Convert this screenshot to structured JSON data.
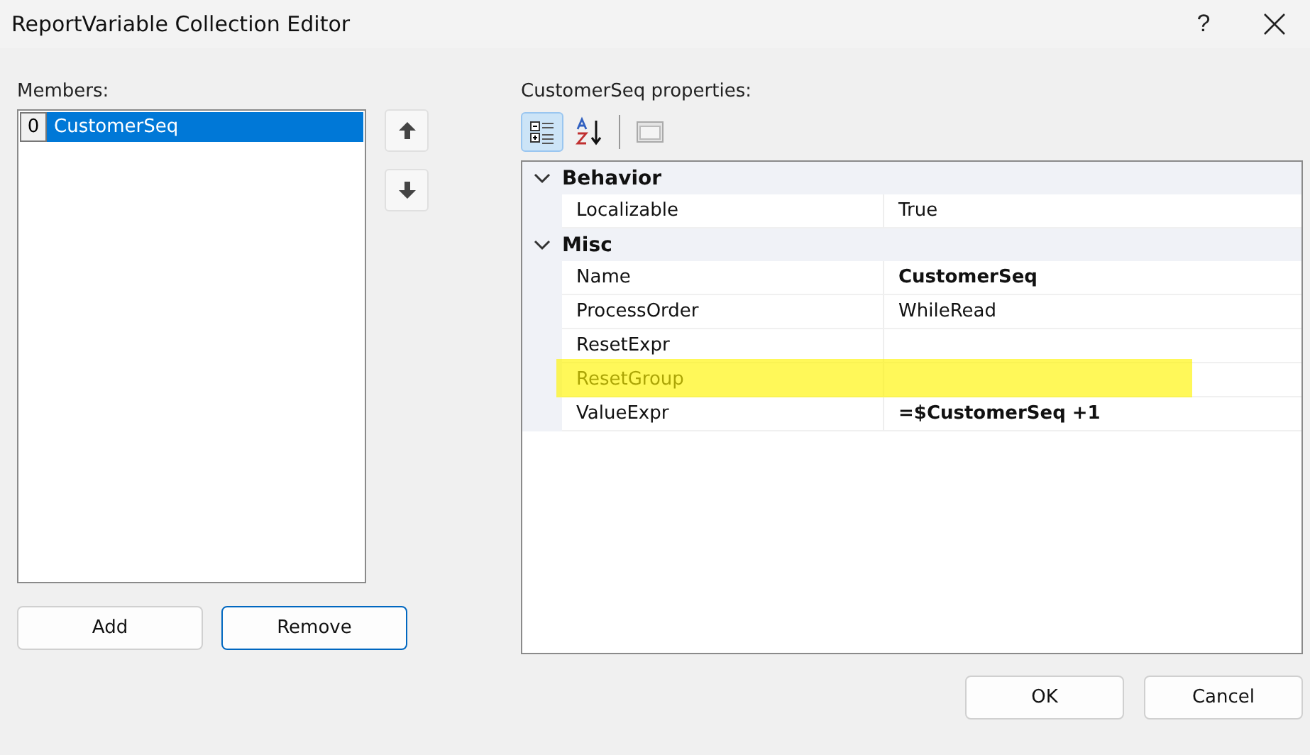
{
  "window": {
    "title": "ReportVariable Collection Editor",
    "help": "?"
  },
  "members": {
    "label": "Members:",
    "items": [
      {
        "index": "0",
        "name": "CustomerSeq",
        "selected": true
      }
    ]
  },
  "member_buttons": [
    {
      "label": "Add",
      "focused": false
    },
    {
      "label": "Remove",
      "focused": true
    }
  ],
  "properties": {
    "label": "CustomerSeq properties:",
    "toolbar": [
      {
        "kind": "categorized",
        "selected": true
      },
      {
        "kind": "alphabetical",
        "selected": false
      },
      {
        "kind": "pages",
        "selected": false
      }
    ],
    "categories": [
      {
        "name": "Behavior",
        "expanded": true,
        "rows": [
          {
            "name": "Localizable",
            "value": "True",
            "bold": false,
            "highlighted": false
          }
        ]
      },
      {
        "name": "Misc",
        "expanded": true,
        "rows": [
          {
            "name": "Name",
            "value": "CustomerSeq",
            "bold": true,
            "highlighted": false
          },
          {
            "name": "ProcessOrder",
            "value": "WhileRead",
            "bold": false,
            "highlighted": false
          },
          {
            "name": "ResetExpr",
            "value": "",
            "bold": false,
            "highlighted": false
          },
          {
            "name": "ResetGroup",
            "value": "",
            "bold": false,
            "highlighted": true
          },
          {
            "name": "ValueExpr",
            "value": "=$CustomerSeq +1",
            "bold": true,
            "highlighted": false
          }
        ]
      }
    ]
  },
  "dialog_buttons": [
    {
      "label": "OK"
    },
    {
      "label": "Cancel"
    }
  ]
}
